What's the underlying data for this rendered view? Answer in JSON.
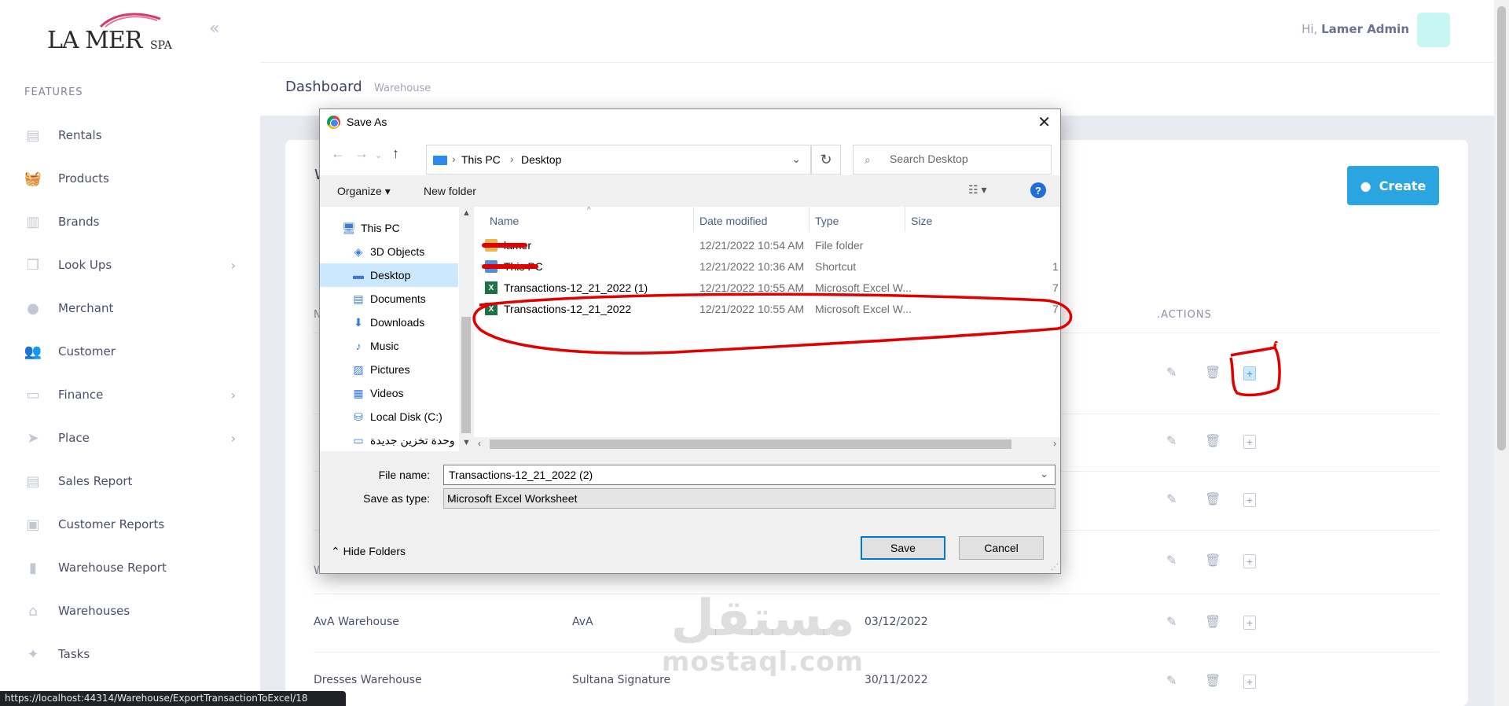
{
  "brand": {
    "logo_main": "LA MER",
    "logo_suffix": "SPA",
    "logo_tiny": "lamer"
  },
  "sidebar": {
    "section_label": "FEATURES",
    "items": [
      {
        "label": "Rentals",
        "icon": "clipboard-icon",
        "has_chevron": false
      },
      {
        "label": "Products",
        "icon": "basket-icon",
        "has_chevron": false
      },
      {
        "label": "Brands",
        "icon": "book-icon",
        "has_chevron": false
      },
      {
        "label": "Look Ups",
        "icon": "copy-icon",
        "has_chevron": true
      },
      {
        "label": "Merchant",
        "icon": "user-icon",
        "has_chevron": false
      },
      {
        "label": "Customer",
        "icon": "users-icon",
        "has_chevron": false
      },
      {
        "label": "Finance",
        "icon": "wallet-icon",
        "has_chevron": true
      },
      {
        "label": "Place",
        "icon": "navigation-icon",
        "has_chevron": true
      },
      {
        "label": "Sales Report",
        "icon": "file-report-icon",
        "has_chevron": false
      },
      {
        "label": "Customer Reports",
        "icon": "id-card-icon",
        "has_chevron": false
      },
      {
        "label": "Warehouse Report",
        "icon": "document-icon",
        "has_chevron": false
      },
      {
        "label": "Warehouses",
        "icon": "warehouse-icon",
        "has_chevron": false
      },
      {
        "label": "Tasks",
        "icon": "puzzle-icon",
        "has_chevron": false
      }
    ]
  },
  "topbar": {
    "greeting_prefix": "Hi,",
    "user_name": "Lamer Admin"
  },
  "breadcrumb": {
    "title": "Dashboard",
    "sub": "Warehouse"
  },
  "card": {
    "title_stub": "W",
    "create_label": "Create",
    "col_actions": ".ACTIONS",
    "col_name_stub": "N",
    "rows": [
      {
        "name": "AvA Warehouse",
        "brand": "AvA",
        "date": "03/12/2022"
      },
      {
        "name": "Dresses Warehouse",
        "brand": "Sultana Signature",
        "date": "30/11/2022"
      }
    ],
    "partial_row_text": "Warehouse"
  },
  "status_url": "https://localhost:44314/Warehouse/ExportTransactionToExcel/18",
  "watermark": {
    "ar": "مستقل",
    "en": "mostaql.com"
  },
  "dialog": {
    "title": "Save As",
    "address": {
      "root": "This PC",
      "folder": "Desktop"
    },
    "search_placeholder": "Search Desktop",
    "organize": "Organize",
    "new_folder": "New folder",
    "nav_tree": [
      {
        "label": "This PC",
        "icon": "computer-icon",
        "selected": false,
        "indent": 28
      },
      {
        "label": "3D Objects",
        "icon": "cube-icon",
        "selected": false,
        "indent": 40
      },
      {
        "label": "Desktop",
        "icon": "desktop-icon",
        "selected": true,
        "indent": 40
      },
      {
        "label": "Documents",
        "icon": "documents-icon",
        "selected": false,
        "indent": 40
      },
      {
        "label": "Downloads",
        "icon": "download-icon",
        "selected": false,
        "indent": 40
      },
      {
        "label": "Music",
        "icon": "music-icon",
        "selected": false,
        "indent": 40
      },
      {
        "label": "Pictures",
        "icon": "pictures-icon",
        "selected": false,
        "indent": 40
      },
      {
        "label": "Videos",
        "icon": "videos-icon",
        "selected": false,
        "indent": 40
      },
      {
        "label": "Local Disk (C:)",
        "icon": "disk-icon",
        "selected": false,
        "indent": 40
      },
      {
        "label": "وحدة تخزين جديدة",
        "icon": "drive-icon",
        "selected": false,
        "indent": 40
      }
    ],
    "columns": {
      "name": "Name",
      "date": "Date modified",
      "type": "Type",
      "size": "Size"
    },
    "files": [
      {
        "name": "lamer",
        "date": "12/21/2022 10:54 AM",
        "type": "File folder",
        "size": "",
        "icon": "folder-icon",
        "redacted": true
      },
      {
        "name": "This PC",
        "date": "12/21/2022 10:36 AM",
        "type": "Shortcut",
        "size": "1",
        "icon": "shortcut-icon",
        "redacted": true
      },
      {
        "name": "Transactions-12_21_2022 (1)",
        "date": "12/21/2022 10:55 AM",
        "type": "Microsoft Excel W...",
        "size": "7",
        "icon": "excel-icon",
        "redacted": false
      },
      {
        "name": "Transactions-12_21_2022",
        "date": "12/21/2022 10:55 AM",
        "type": "Microsoft Excel W...",
        "size": "7",
        "icon": "excel-icon",
        "redacted": false
      }
    ],
    "file_name_label": "File name:",
    "file_name_value": "Transactions-12_21_2022 (2)",
    "save_type_label": "Save as type:",
    "save_type_value": "Microsoft Excel Worksheet",
    "hide_folders": "Hide Folders",
    "save_label": "Save",
    "cancel_label": "Cancel"
  },
  "colors": {
    "accent": "#2aa5df",
    "annotation": "#e00000",
    "selection": "#cce8ff"
  }
}
